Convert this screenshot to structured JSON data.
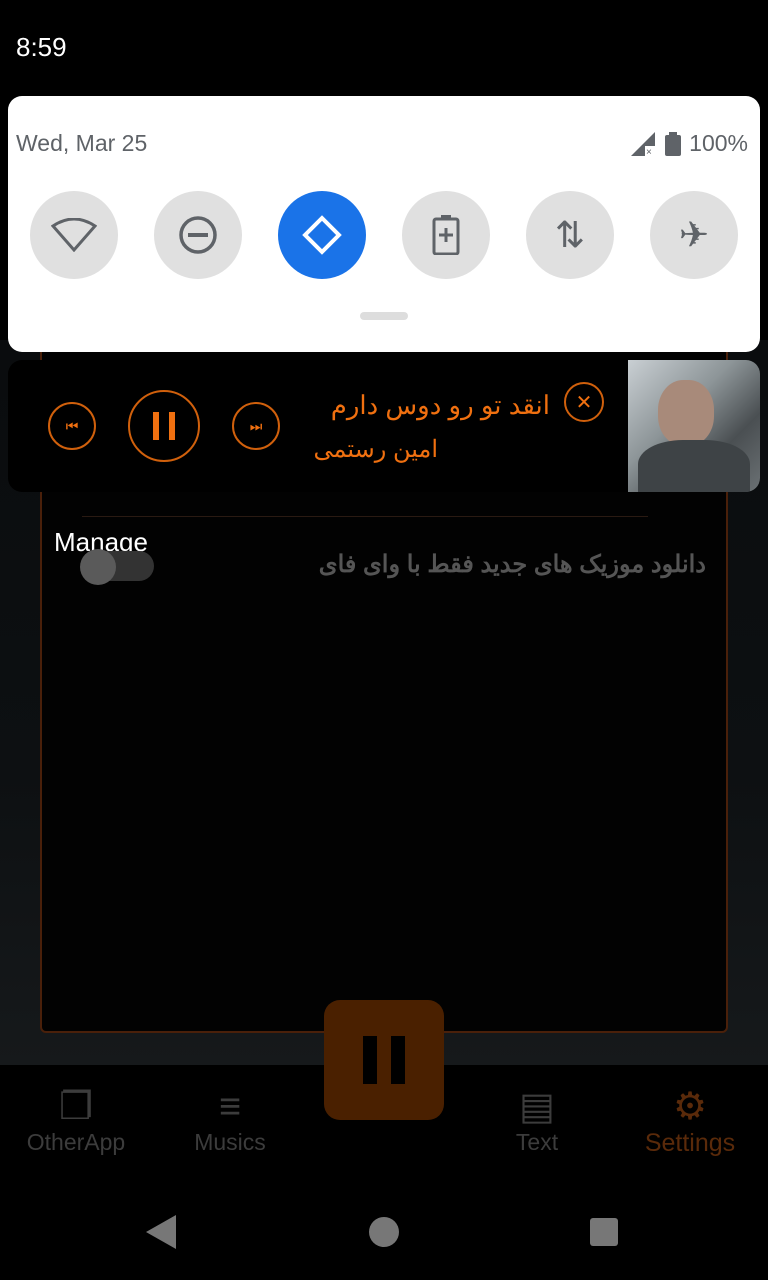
{
  "status_bar": {
    "time": "8:59"
  },
  "quick_settings": {
    "date": "Wed, Mar 25",
    "battery": "100%",
    "tiles": [
      {
        "icon": "wifi-icon",
        "active": false
      },
      {
        "icon": "do-not-disturb-icon",
        "active": false
      },
      {
        "icon": "auto-rotate-icon",
        "active": true
      },
      {
        "icon": "battery-saver-icon",
        "active": false
      },
      {
        "icon": "mobile-data-icon",
        "active": false
      },
      {
        "icon": "airplane-mode-icon",
        "active": false
      }
    ],
    "accent": "#1a73e8"
  },
  "media": {
    "title": "انقد تو رو دوس دارم",
    "artist": "امین رستمی",
    "accent": "#f07010"
  },
  "settings": {
    "manage_label": "Manage",
    "wifi_only_label": "دانلود موزیک های جدید فقط با وای فای",
    "wifi_only_enabled": false
  },
  "bottom_nav": {
    "items": [
      "OtherApp",
      "Musics",
      "Text",
      "Settings"
    ],
    "active": "Settings"
  }
}
